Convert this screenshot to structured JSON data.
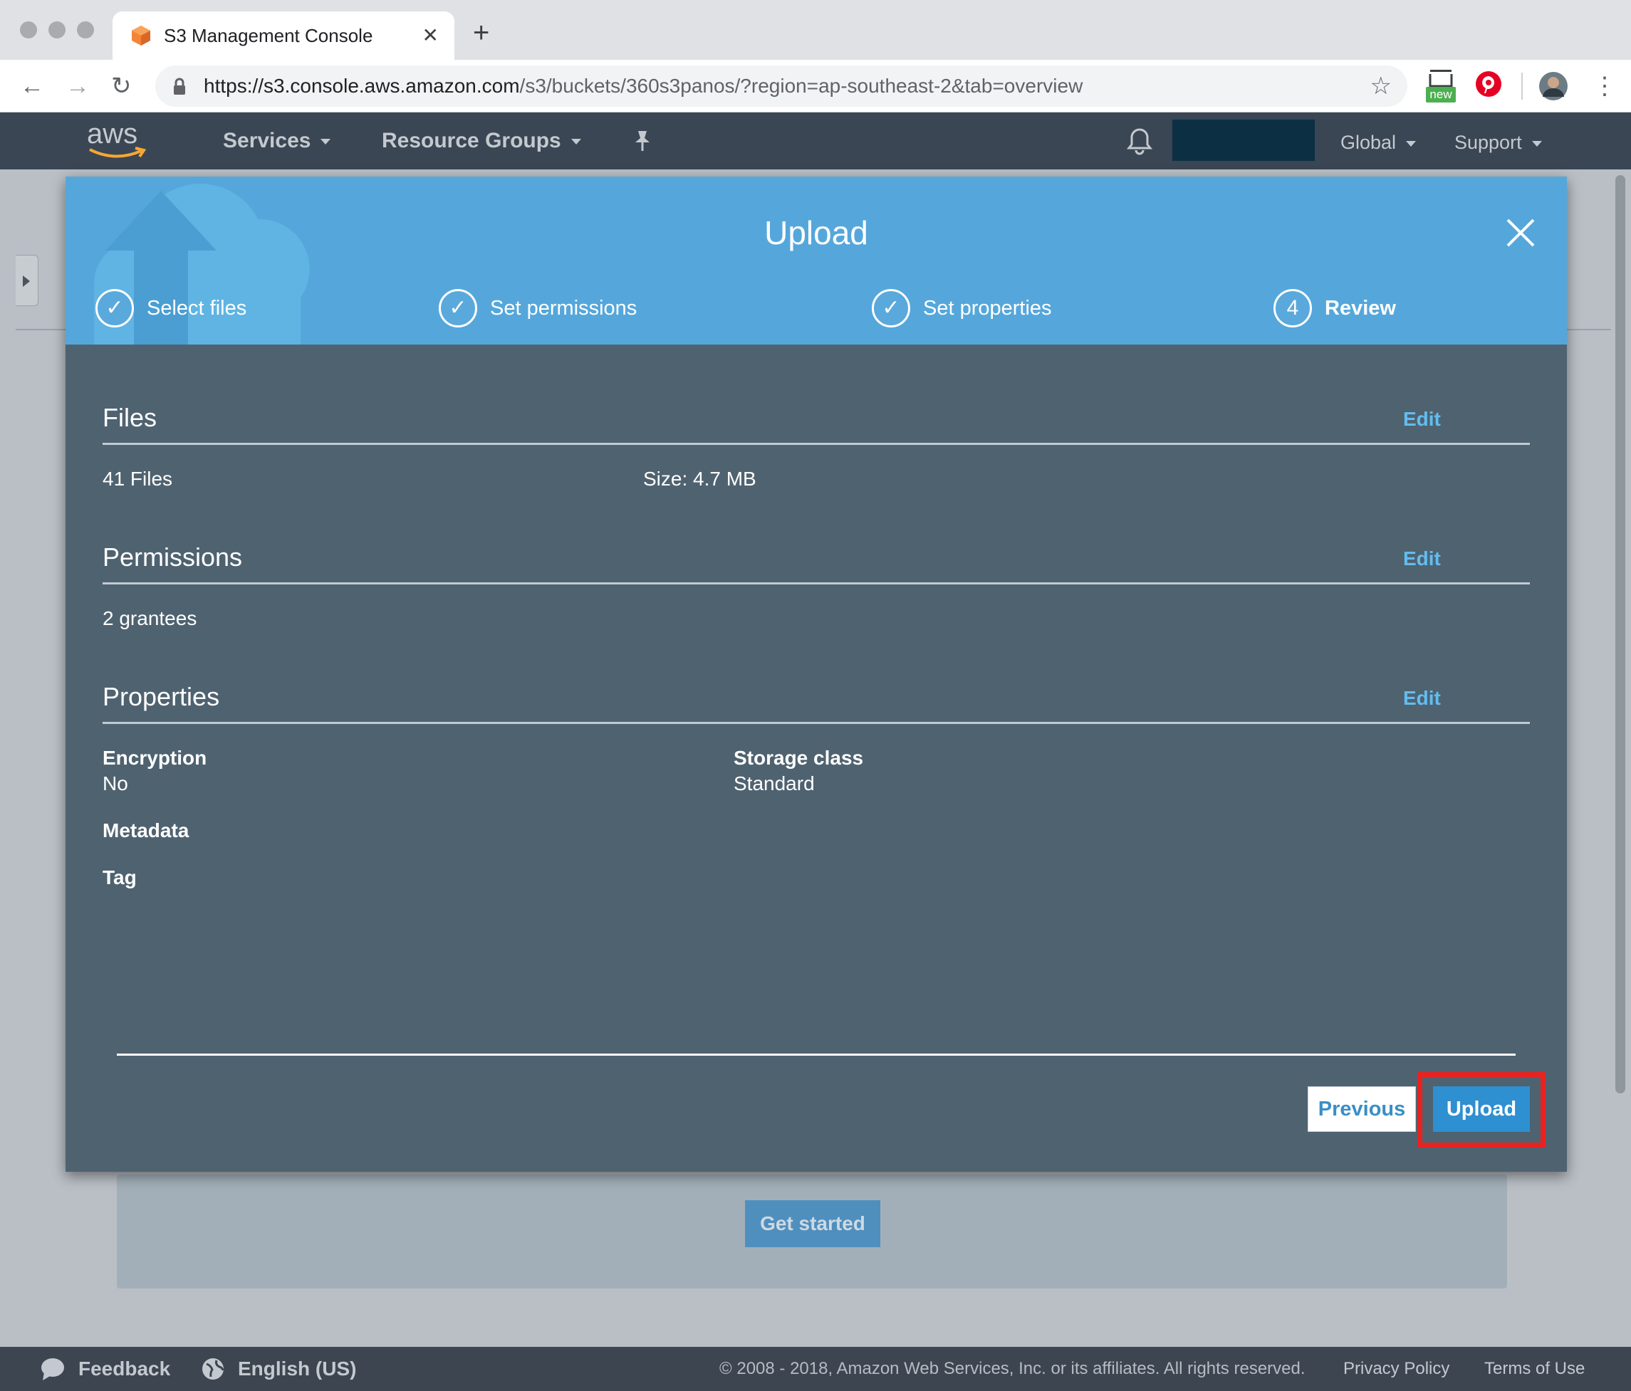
{
  "browser": {
    "tab_title": "S3 Management Console",
    "url_host": "https://s3.console.aws.amazon.com",
    "url_path": "/s3/buckets/360s3panos/?region=ap-southeast-2&tab=overview",
    "extension_badge": "new"
  },
  "aws_nav": {
    "logo_text": "aws",
    "services": "Services",
    "resource_groups": "Resource Groups",
    "region": "Global",
    "support": "Support"
  },
  "background": {
    "get_started": "Get started"
  },
  "modal": {
    "title": "Upload",
    "steps": [
      {
        "label": "Select files",
        "state": "done"
      },
      {
        "label": "Set permissions",
        "state": "done"
      },
      {
        "label": "Set properties",
        "state": "done"
      },
      {
        "label": "Review",
        "state": "current",
        "number": "4"
      }
    ],
    "files": {
      "title": "Files",
      "edit": "Edit",
      "count": "41 Files",
      "size": "Size: 4.7 MB"
    },
    "permissions": {
      "title": "Permissions",
      "edit": "Edit",
      "grantees": "2 grantees"
    },
    "properties": {
      "title": "Properties",
      "edit": "Edit",
      "encryption_label": "Encryption",
      "encryption_value": "No",
      "storage_class_label": "Storage class",
      "storage_class_value": "Standard",
      "metadata_label": "Metadata",
      "tag_label": "Tag"
    },
    "previous": "Previous",
    "upload": "Upload"
  },
  "footer": {
    "feedback": "Feedback",
    "language": "English (US)",
    "copyright": "© 2008 - 2018, Amazon Web Services, Inc. or its affiliates. All rights reserved.",
    "privacy": "Privacy Policy",
    "terms": "Terms of Use"
  },
  "colors": {
    "modal_header": "#55a7db",
    "modal_body": "#4f6270",
    "link": "#62bdf0",
    "primary_button": "#2e8fd1",
    "highlight": "#e8221f"
  }
}
